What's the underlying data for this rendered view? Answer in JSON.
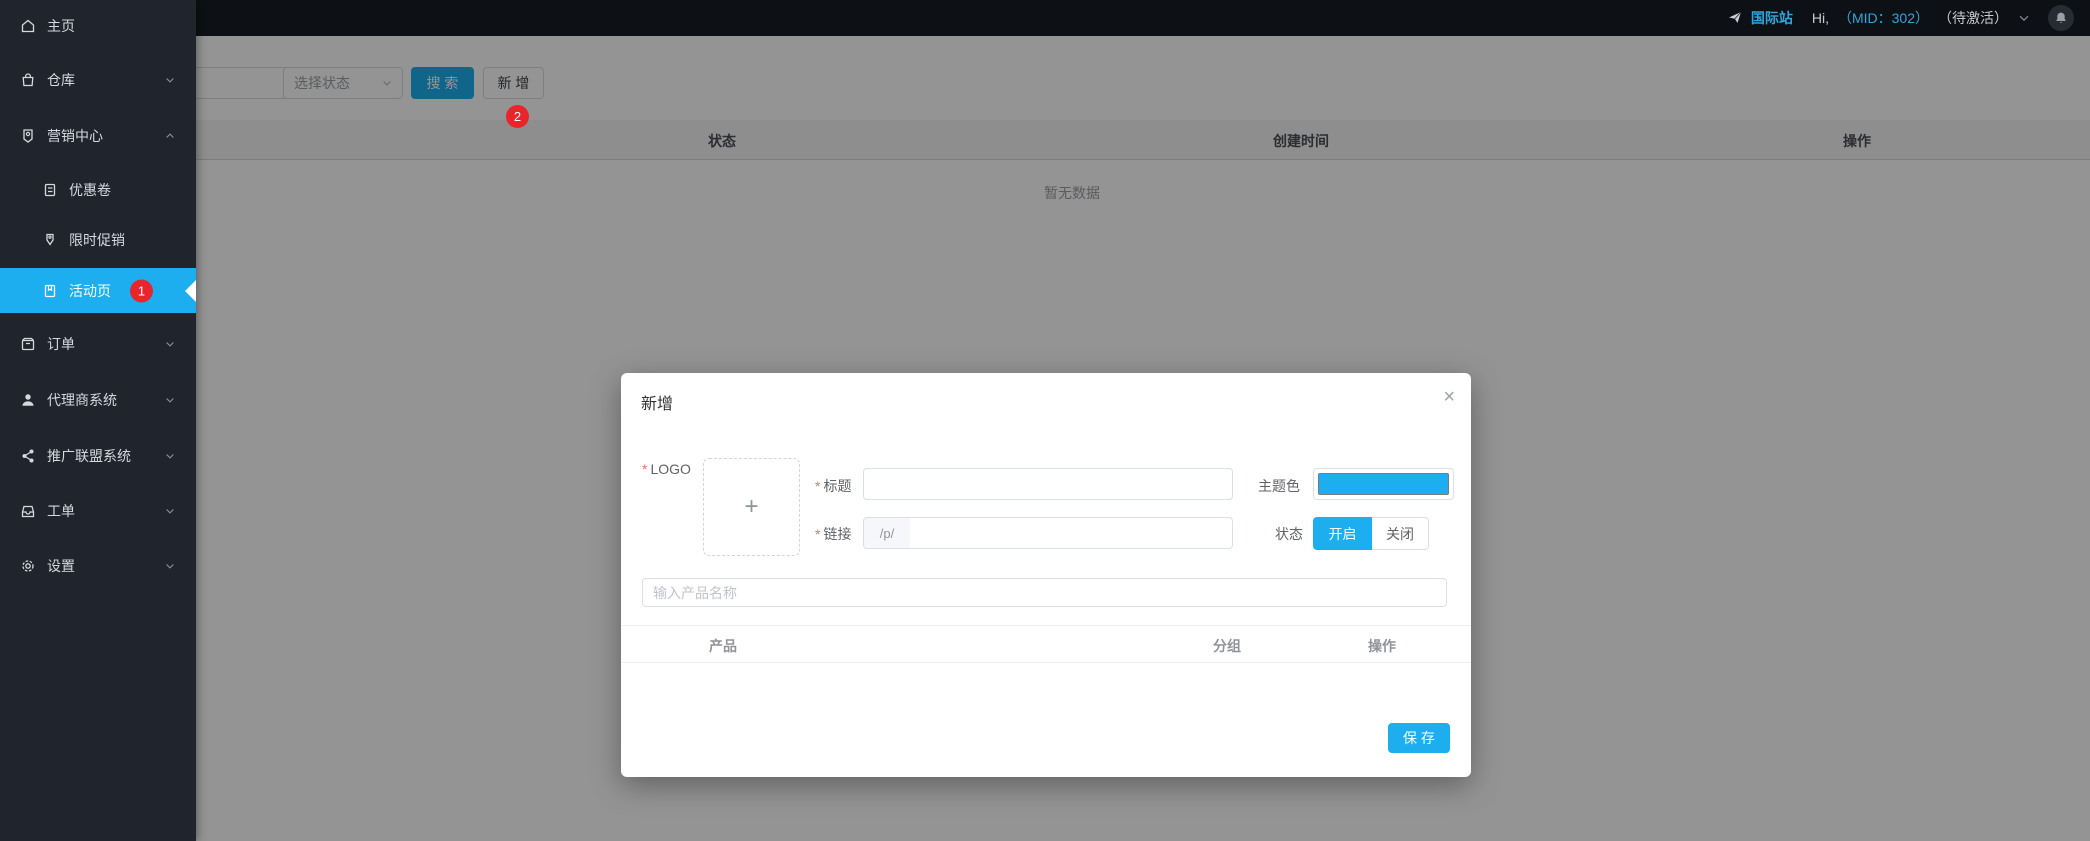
{
  "colors": {
    "accent": "#1daef0",
    "badge": "#e9242b",
    "sidebar_bg": "#20242c",
    "header_bg": "#0d1014"
  },
  "header": {
    "brand": "国际站",
    "greeting": "Hi,",
    "mid": "（MID：302）",
    "account_status": "（待激活）",
    "icons": {
      "plane": "paper-plane-icon",
      "chevron": "chevron-down-icon",
      "bell": "bell-icon"
    }
  },
  "sidebar": {
    "items": [
      {
        "label": "主页",
        "icon": "home-icon"
      },
      {
        "label": "仓库",
        "icon": "bag-icon",
        "chevron": "down"
      },
      {
        "label": "营销中心",
        "icon": "marketing-icon",
        "chevron": "up",
        "expanded": true,
        "children": [
          {
            "label": "优惠卷",
            "icon": "coupon-icon"
          },
          {
            "label": "限时促销",
            "icon": "tag-icon"
          },
          {
            "label": "活动页",
            "icon": "activity-icon",
            "active": true,
            "badge": "1"
          }
        ]
      },
      {
        "label": "订单",
        "icon": "order-icon",
        "chevron": "down"
      },
      {
        "label": "代理商系统",
        "icon": "agent-icon",
        "chevron": "down"
      },
      {
        "label": "推广联盟系统",
        "icon": "share-icon",
        "chevron": "down"
      },
      {
        "label": "工单",
        "icon": "ticket-icon",
        "chevron": "down"
      },
      {
        "label": "设置",
        "icon": "gear-icon",
        "chevron": "down"
      }
    ]
  },
  "toolbar": {
    "status_placeholder": "选择状态",
    "search": "搜 索",
    "add": "新 增",
    "add_badge": "2",
    "keyword_value": ""
  },
  "table": {
    "columns": [
      "状态",
      "创建时间",
      "操作"
    ],
    "empty": "暂无数据"
  },
  "modal": {
    "title": "新增",
    "close": "×",
    "required_mark": "*",
    "logo_label": "LOGO",
    "upload_plus": "+",
    "title_label": "标题",
    "title_value": "",
    "theme_label": "主题色",
    "theme_color": "#1daef0",
    "link_label": "链接",
    "link_prefix": "/p/",
    "link_value": "",
    "status_label": "状态",
    "status_on": "开启",
    "status_off": "关闭",
    "status_selected": "开启",
    "product_placeholder": "输入产品名称",
    "columns": [
      "产品",
      "分组",
      "操作"
    ],
    "save": "保 存"
  }
}
